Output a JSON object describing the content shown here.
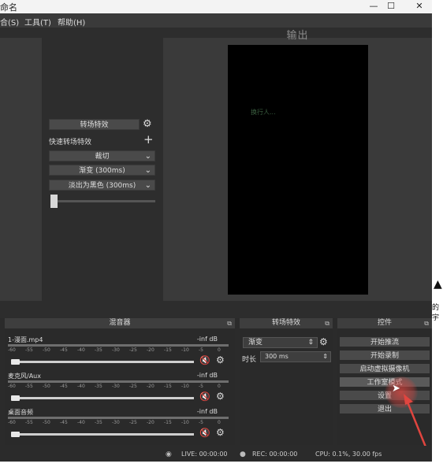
{
  "window": {
    "title_fragment": "命名",
    "controls": {
      "minimize": "—",
      "maximize": "☐",
      "close": "✕"
    }
  },
  "menu": [
    {
      "label": "合(S)"
    },
    {
      "label": "工具(T)"
    },
    {
      "label": "帮助(H)"
    }
  ],
  "preview": {
    "output_label": "输出",
    "screen_text": "换行人..."
  },
  "outside": {
    "frag1": "▲",
    "frag2": "的宇"
  },
  "transition_panel": {
    "transition_effect_button": "转场特效",
    "quick_transition_label": "快速转场特效",
    "add_icon": "+",
    "items": [
      {
        "label": "裁切"
      },
      {
        "label": "渐变 (300ms)"
      },
      {
        "label": "淡出为黑色 (300ms)"
      }
    ]
  },
  "mixer": {
    "title": "混音器",
    "ticks": [
      "-60",
      "-55",
      "-50",
      "-45",
      "-40",
      "-35",
      "-30",
      "-25",
      "-20",
      "-15",
      "-10",
      "-5",
      "0"
    ],
    "channels": [
      {
        "name": "1-漫面.mp4",
        "db": "-inf dB"
      },
      {
        "name": "麦克风/Aux",
        "db": "-inf dB"
      },
      {
        "name": "桌面音频",
        "db": "-inf dB"
      }
    ]
  },
  "transitions_dock": {
    "title": "转场特效",
    "selected": "渐变",
    "duration_label": "时长",
    "duration_value": "300 ms"
  },
  "controls": {
    "title": "控件",
    "buttons": [
      {
        "label": "开始推流"
      },
      {
        "label": "开始录制"
      },
      {
        "label": "启动虚拟摄像机"
      },
      {
        "label": "工作室模式"
      },
      {
        "label": "设置"
      },
      {
        "label": "退出"
      }
    ]
  },
  "status": {
    "live": "LIVE: 00:00:00",
    "rec": "REC: 00:00:00",
    "cpu": "CPU: 0.1%, 30.00 fps"
  },
  "colors": {
    "accent_red": "#d43a3a",
    "highlight_red": "#e0453f",
    "panel": "#3a3a3a",
    "background": "#2b2b2b"
  }
}
